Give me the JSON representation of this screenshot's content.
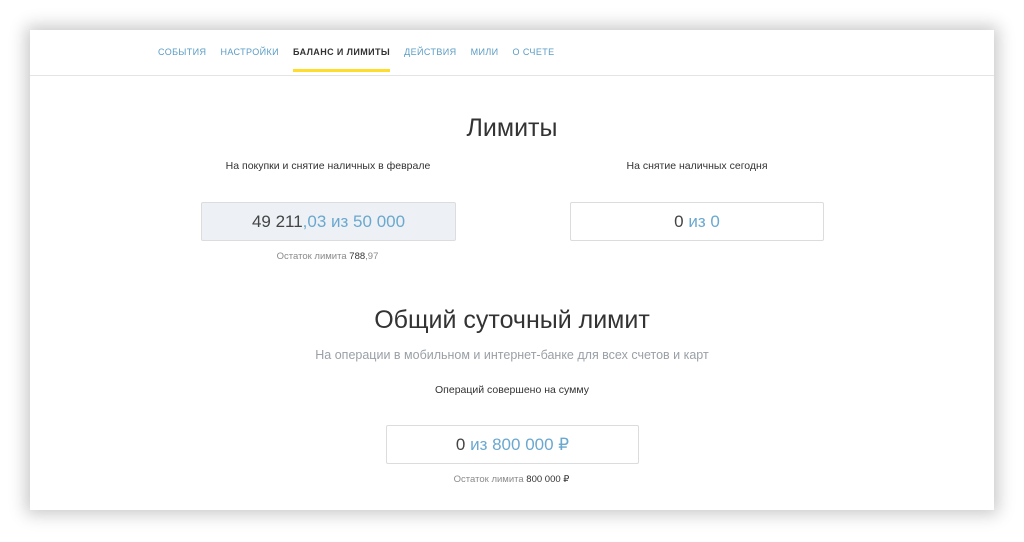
{
  "nav": {
    "tabs": [
      {
        "label": "СОБЫТИЯ"
      },
      {
        "label": "НАСТРОЙКИ"
      },
      {
        "label": "БАЛАНС И ЛИМИТЫ"
      },
      {
        "label": "ДЕЙСТВИЯ"
      },
      {
        "label": "МИЛИ"
      },
      {
        "label": "О СЧЕТЕ"
      }
    ],
    "active_index": 2
  },
  "limits": {
    "title": "Лимиты",
    "purchase": {
      "label": "На покупки и снятие наличных в феврале",
      "spent_int": "49 211",
      "spent_frac": ",03",
      "of": "из 50 000",
      "remainder_label": "Остаток лимита",
      "remainder_int": "788",
      "remainder_frac": ",97"
    },
    "cash": {
      "label": "На снятие наличных сегодня",
      "spent": "0",
      "of": "из 0"
    }
  },
  "daily": {
    "title": "Общий суточный лимит",
    "subtitle": "На операции в мобильном и интернет-банке для всех счетов и карт",
    "ops_label": "Операций совершено на сумму",
    "spent": "0",
    "of": "из 800 000 ₽",
    "remainder_label": "Остаток лимита",
    "remainder_value": "800 000 ₽"
  },
  "colors": {
    "accent_yellow": "#ffdd2d",
    "link_blue": "#5a9cc4",
    "filled_box": "#edf1f5"
  }
}
